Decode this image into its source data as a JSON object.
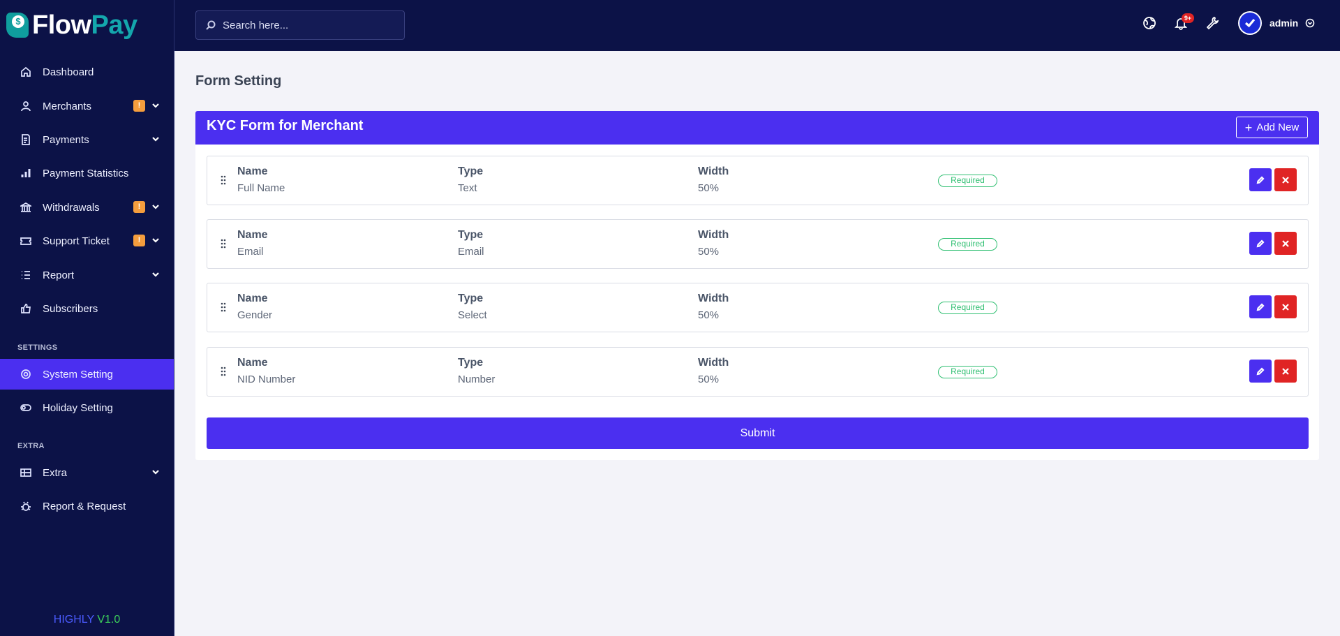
{
  "brand": {
    "part1": "Flow",
    "part2": "Pay"
  },
  "search": {
    "placeholder": "Search here..."
  },
  "topbar": {
    "notification_count": "9+",
    "user_name": "admin"
  },
  "sidebar": {
    "items": [
      {
        "label": "Dashboard",
        "icon": "home-icon"
      },
      {
        "label": "Merchants",
        "icon": "user-icon",
        "badge": "!"
      },
      {
        "label": "Payments",
        "icon": "receipt-icon"
      },
      {
        "label": "Payment Statistics",
        "icon": "bar-chart-icon"
      },
      {
        "label": "Withdrawals",
        "icon": "bank-icon",
        "badge": "!"
      },
      {
        "label": "Support Ticket",
        "icon": "ticket-icon",
        "badge": "!"
      },
      {
        "label": "Report",
        "icon": "list-icon"
      },
      {
        "label": "Subscribers",
        "icon": "thumbs-up-icon"
      },
      {
        "label": "System Setting",
        "icon": "settings-icon"
      },
      {
        "label": "Holiday Setting",
        "icon": "toggle-icon"
      },
      {
        "label": "Extra",
        "icon": "table-icon"
      },
      {
        "label": "Report & Request",
        "icon": "bug-icon"
      }
    ],
    "section_settings": "SETTINGS",
    "section_extra": "EXTRA",
    "version_1": "HIGHLY",
    "version_2": "V1.0"
  },
  "page": {
    "title": "Form Setting",
    "card_title": "KYC Form for Merchant",
    "add_new_label": "Add New",
    "submit_label": "Submit",
    "col_name": "Name",
    "col_type": "Type",
    "col_width": "Width",
    "fields": [
      {
        "name": "Full Name",
        "type": "Text",
        "width": "50%",
        "status": "Required"
      },
      {
        "name": "Email",
        "type": "Email",
        "width": "50%",
        "status": "Required"
      },
      {
        "name": "Gender",
        "type": "Select",
        "width": "50%",
        "status": "Required"
      },
      {
        "name": "NID Number",
        "type": "Number",
        "width": "50%",
        "status": "Required"
      }
    ]
  },
  "colors": {
    "sidebar_bg": "#0c1247",
    "accent": "#4b2ff0",
    "danger": "#e02424",
    "success": "#2fbf71",
    "warning": "#f59d3d"
  }
}
